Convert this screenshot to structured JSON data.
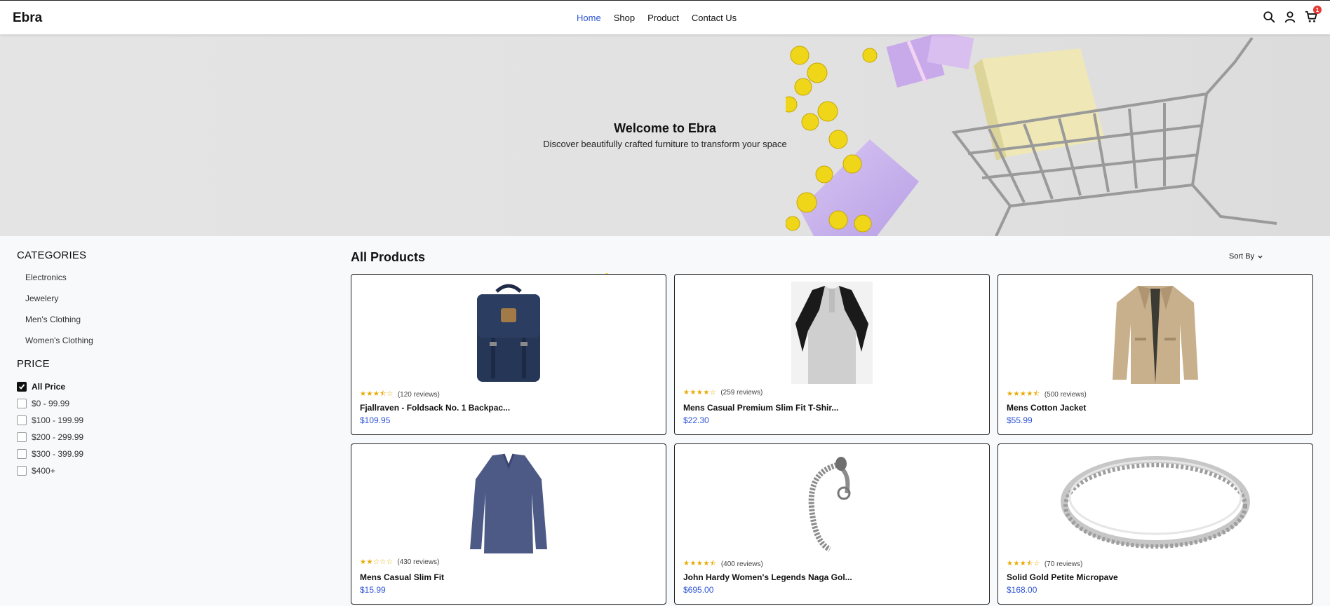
{
  "header": {
    "logo": "Ebra",
    "nav": [
      {
        "label": "Home",
        "active": true
      },
      {
        "label": "Shop",
        "active": false
      },
      {
        "label": "Product",
        "active": false
      },
      {
        "label": "Contact Us",
        "active": false
      }
    ],
    "cart_count": "1",
    "icons": [
      "search-icon",
      "user-icon",
      "cart-icon"
    ]
  },
  "hero": {
    "title": "Welcome to Ebra",
    "subtitle": "Discover beautifully crafted furniture to transform your space"
  },
  "sidebar": {
    "categories_heading": "CATEGORIES",
    "categories": [
      "Electronics",
      "Jewelery",
      "Men's Clothing",
      "Women's Clothing"
    ],
    "price_heading": "PRICE",
    "prices": [
      {
        "label": "All Price",
        "checked": true
      },
      {
        "label": "$0 - 99.99",
        "checked": false
      },
      {
        "label": "$100 - 199.99",
        "checked": false
      },
      {
        "label": "$200 - 299.99",
        "checked": false
      },
      {
        "label": "$300 - 399.99",
        "checked": false
      },
      {
        "label": "$400+",
        "checked": false
      }
    ]
  },
  "main": {
    "title": "All Products",
    "sort_label": "Sort By",
    "products": [
      {
        "name": "Fjallraven - Foldsack No. 1 Backpac...",
        "reviews": "(120 reviews)",
        "price": "$109.95",
        "rating": 3.5,
        "image": "backpack"
      },
      {
        "name": "Mens Casual Premium Slim Fit T-Shir...",
        "reviews": "(259 reviews)",
        "price": "$22.30",
        "rating": 4,
        "image": "tshirt"
      },
      {
        "name": "Mens Cotton Jacket",
        "reviews": "(500 reviews)",
        "price": "$55.99",
        "rating": 4.5,
        "image": "jacket"
      },
      {
        "name": "Mens Casual Slim Fit",
        "reviews": "(430 reviews)",
        "price": "$15.99",
        "rating": 2,
        "image": "longsleeve"
      },
      {
        "name": "John Hardy Women's Legends Naga Gol...",
        "reviews": "(400 reviews)",
        "price": "$695.00",
        "rating": 4.5,
        "image": "bracelet"
      },
      {
        "name": "Solid Gold Petite Micropave",
        "reviews": "(70 reviews)",
        "price": "$168.00",
        "rating": 3.5,
        "image": "ring"
      }
    ]
  },
  "colors": {
    "accent": "#2f55d4",
    "star": "#e8a900",
    "badge": "#e53935"
  }
}
